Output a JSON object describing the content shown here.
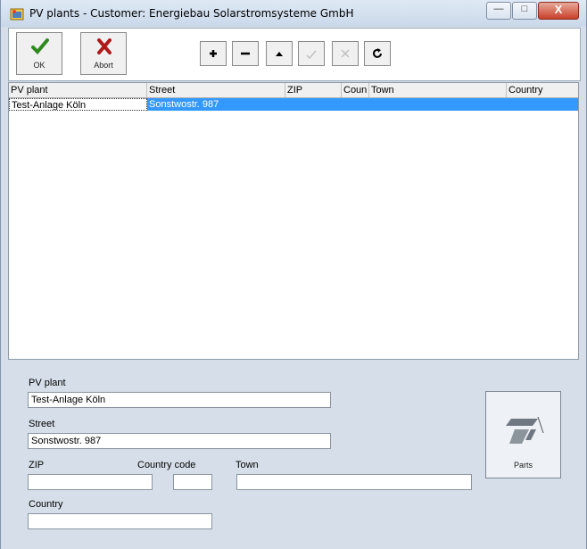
{
  "window": {
    "title": "PV plants - Customer: Energiebau Solarstromsysteme GmbH",
    "controls": {
      "minimize": "—",
      "maximize": "□",
      "close": "X"
    }
  },
  "toolbar": {
    "ok_label": "OK",
    "abort_label": "Abort",
    "small_buttons": [
      "add-icon",
      "remove-icon",
      "move-up-icon",
      "confirm-icon",
      "cancel-icon",
      "refresh-icon"
    ],
    "colors": {
      "ok": "#2f8a1e",
      "abort": "#b01818"
    }
  },
  "list": {
    "columns": [
      "PV plant",
      "Street",
      "ZIP",
      "Coun",
      "Town",
      "Country"
    ],
    "rows": [
      {
        "pv_plant": "Test-Anlage Köln",
        "street": "Sonstwostr. 987",
        "zip": "",
        "coun": "",
        "town": "",
        "country": ""
      }
    ],
    "selection_color": "#3399ff"
  },
  "detail": {
    "pv_plant": {
      "label": "PV plant",
      "value": "Test-Anlage Köln"
    },
    "street": {
      "label": "Street",
      "value": "Sonstwostr. 987"
    },
    "zip": {
      "label": "ZIP",
      "value": ""
    },
    "country_code": {
      "label": "Country code",
      "value": ""
    },
    "town": {
      "label": "Town",
      "value": ""
    },
    "country": {
      "label": "Country",
      "value": ""
    },
    "parts_label": "Parts"
  }
}
